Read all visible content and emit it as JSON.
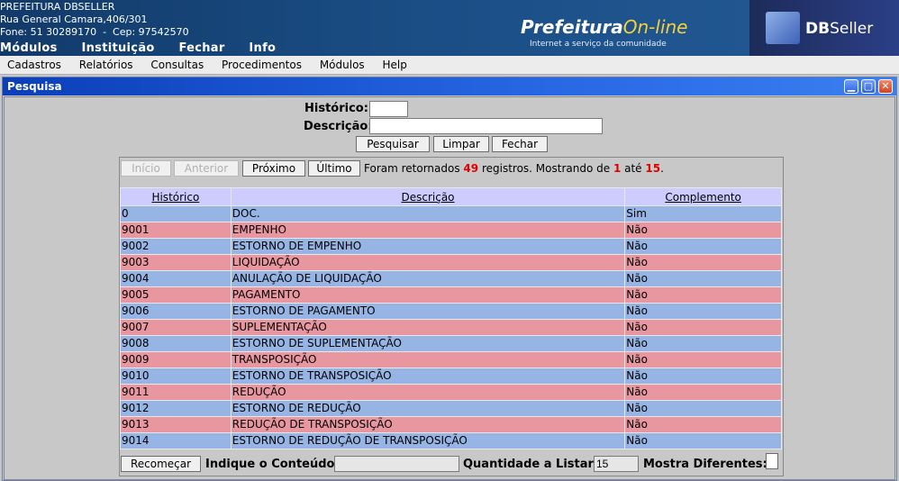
{
  "header": {
    "org_name": "PREFEITURA DBSELLER",
    "address": "Rua General Camara,406/301",
    "phone": "Fone: 51 30289170  -  Cep: 97542570",
    "top_menu": [
      "Módulos",
      "Instituição",
      "Fechar",
      "Info"
    ],
    "brand_main": "Prefeitura",
    "brand_script": "On-line",
    "brand_tagline": "Internet a serviço da comunidade",
    "vendor_logo_bold": "DB",
    "vendor_logo_rest": "Seller"
  },
  "menubar": [
    "Cadastros",
    "Relatórios",
    "Consultas",
    "Procedimentos",
    "Módulos",
    "Help"
  ],
  "window": {
    "title": "Pesquisa",
    "minimize_icon": "minimize-icon",
    "maximize_icon": "maximize-icon",
    "close_icon": "close-icon"
  },
  "search_form": {
    "historico_label": "Histórico:",
    "historico_value": "",
    "descricao_label": "Descrição:",
    "descricao_value": "",
    "pesquisar_label": "Pesquisar",
    "limpar_label": "Limpar",
    "fechar_label": "Fechar"
  },
  "pagination": {
    "inicio_label": "Início",
    "anterior_label": "Anterior",
    "proximo_label": "Próximo",
    "ultimo_label": "Último",
    "text_prefix": "Foram retornados ",
    "total": "49",
    "text_middle": " registros. Mostrando de ",
    "from": "1",
    "text_until": " até ",
    "to": "15",
    "text_end": "."
  },
  "table": {
    "columns": [
      "Histórico",
      "Descrição",
      "Complemento"
    ],
    "rows": [
      {
        "historico": "0",
        "descricao": "DOC.",
        "complemento": "Sim"
      },
      {
        "historico": "9001",
        "descricao": "EMPENHO",
        "complemento": "Não"
      },
      {
        "historico": "9002",
        "descricao": "ESTORNO DE EMPENHO",
        "complemento": "Não"
      },
      {
        "historico": "9003",
        "descricao": "LIQUIDAÇÃO",
        "complemento": "Não"
      },
      {
        "historico": "9004",
        "descricao": "ANULAÇÃO DE LIQUIDAÇÃO",
        "complemento": "Não"
      },
      {
        "historico": "9005",
        "descricao": "PAGAMENTO",
        "complemento": "Não"
      },
      {
        "historico": "9006",
        "descricao": "ESTORNO DE PAGAMENTO",
        "complemento": "Não"
      },
      {
        "historico": "9007",
        "descricao": "SUPLEMENTAÇÃO",
        "complemento": "Não"
      },
      {
        "historico": "9008",
        "descricao": "ESTORNO DE SUPLEMENTAÇÃO",
        "complemento": "Não"
      },
      {
        "historico": "9009",
        "descricao": "TRANSPOSIÇÃO",
        "complemento": "Não"
      },
      {
        "historico": "9010",
        "descricao": "ESTORNO DE TRANSPOSIÇÃO",
        "complemento": "Não"
      },
      {
        "historico": "9011",
        "descricao": "REDUÇÃO",
        "complemento": "Não"
      },
      {
        "historico": "9012",
        "descricao": "ESTORNO DE REDUÇÃO",
        "complemento": "Não"
      },
      {
        "historico": "9013",
        "descricao": "REDUÇÃO DE TRANSPOSIÇÃO",
        "complemento": "Não"
      },
      {
        "historico": "9014",
        "descricao": "ESTORNO DE REDUÇÃO DE TRANSPOSIÇÃO",
        "complemento": "Não"
      }
    ],
    "row_colors": {
      "even": "#96b4e4",
      "odd": "#e896a0",
      "header": "#ccccff"
    }
  },
  "footer": {
    "recomecar_label": "Recomeçar",
    "indique_label": "Indique o Conteúdo:",
    "indique_value": "",
    "quantidade_label": "Quantidade a Listar:",
    "quantidade_value": "15",
    "mostra_label": "Mostra Diferentes:"
  },
  "colors": {
    "titlebar": "#2767e3",
    "highlight_number": "#e00000"
  }
}
